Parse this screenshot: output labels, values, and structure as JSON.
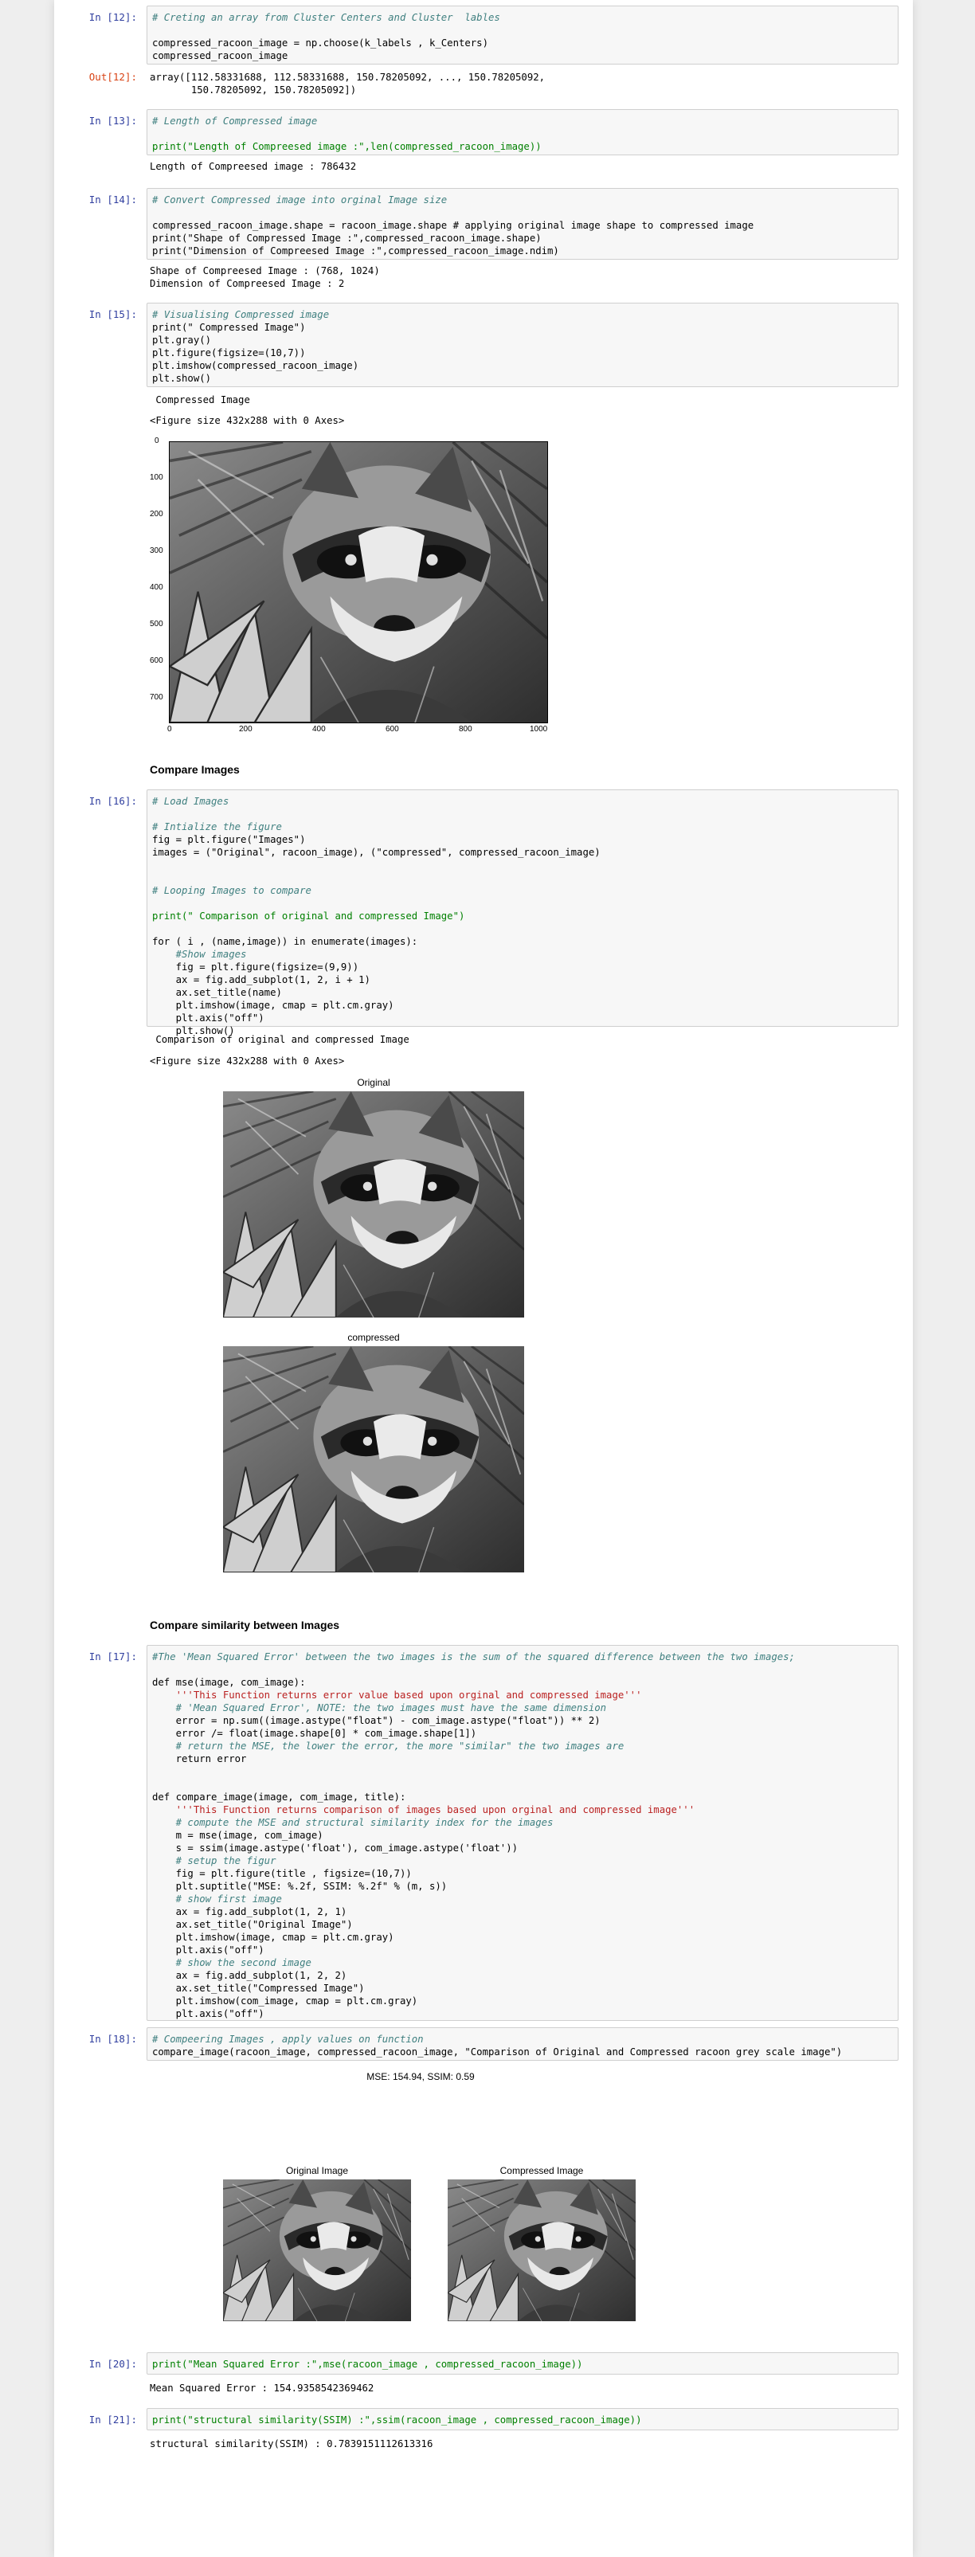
{
  "cells": {
    "c12": {
      "in_prompt": "In [12]:",
      "out_prompt": "Out[12]:",
      "code": [
        "# Creting an array from Cluster Centers and Cluster  lables",
        "",
        "compressed_racoon_image = np.choose(k_labels , k_Centers)",
        "compressed_racoon_image"
      ],
      "output": [
        "array([112.58331688, 112.58331688, 150.78205092, ..., 150.78205092,",
        "       150.78205092, 150.78205092])"
      ]
    },
    "c13": {
      "in_prompt": "In [13]:",
      "code": [
        "# Length of Compressed image",
        "",
        "print(\"Length of Compreesed image :\",len(compressed_racoon_image))"
      ],
      "output": "Length of Compreesed image : 786432"
    },
    "c14": {
      "in_prompt": "In [14]:",
      "code": [
        "# Convert Compressed image into orginal Image size",
        "",
        "compressed_racoon_image.shape = racoon_image.shape # applying original image shape to compressed image",
        "print(\"Shape of Compressed Image :\",compressed_racoon_image.shape)",
        "print(\"Dimension of Compreesed Image :\",compressed_racoon_image.ndim)"
      ],
      "output": [
        "Shape of Compreesed Image : (768, 1024)",
        "Dimension of Compreesed Image : 2"
      ]
    },
    "c15": {
      "in_prompt": "In [15]:",
      "code": [
        "# Visualising Compressed image",
        "print(\" Compressed Image\")",
        "plt.gray()",
        "plt.figure(figsize=(10,7))",
        "plt.imshow(compressed_racoon_image)",
        "plt.show()"
      ],
      "output_1": " Compressed Image",
      "output_2": "<Figure size 432x288 with 0 Axes>",
      "y_ticks": [
        "0",
        "100",
        "200",
        "300",
        "400",
        "500",
        "600",
        "700"
      ],
      "x_ticks": [
        "0",
        "200",
        "400",
        "600",
        "800",
        "1000"
      ]
    },
    "md_compare": "Compare Images",
    "c16": {
      "in_prompt": "In [16]:",
      "code": [
        "# Load Images",
        "",
        "# Intialize the figure",
        "fig = plt.figure(\"Images\")",
        "images = (\"Original\", racoon_image), (\"compressed\", compressed_racoon_image)",
        "",
        "",
        "# Looping Images to compare",
        "",
        "print(\" Comparison of original and compressed Image\")",
        "",
        "for ( i , (name,image)) in enumerate(images):",
        "    #Show images",
        "    fig = plt.figure(figsize=(9,9))",
        "    ax = fig.add_subplot(1, 2, i + 1)",
        "    ax.set_title(name)",
        "    plt.imshow(image, cmap = plt.cm.gray)",
        "    plt.axis(\"off\")",
        "    plt.show()"
      ],
      "output_1": " Comparison of original and compressed Image",
      "output_2": "<Figure size 432x288 with 0 Axes>",
      "title_original": "Original",
      "title_compressed": "compressed"
    },
    "md_similarity": "Compare similarity between Images",
    "c17": {
      "in_prompt": "In [17]:",
      "code": [
        "#The 'Mean Squared Error' between the two images is the sum of the squared difference between the two images;",
        "",
        "def mse(image, com_image):",
        "    '''This Function returns error value based upon orginal and compressed image'''",
        "    # 'Mean Squared Error', NOTE: the two images must have the same dimension",
        "    error = np.sum((image.astype(\"float\") - com_image.astype(\"float\")) ** 2)",
        "    error /= float(image.shape[0] * com_image.shape[1])",
        "    # return the MSE, the lower the error, the more \"similar\" the two images are",
        "    return error",
        "",
        "",
        "def compare_image(image, com_image, title):",
        "    '''This Function returns comparison of images based upon orginal and compressed image'''",
        "    # compute the MSE and structural similarity index for the images",
        "    m = mse(image, com_image)",
        "    s = ssim(image.astype('float'), com_image.astype('float'))",
        "    # setup the figur",
        "    fig = plt.figure(title , figsize=(10,7))",
        "    plt.suptitle(\"MSE: %.2f, SSIM: %.2f\" % (m, s))",
        "    # show first image",
        "    ax = fig.add_subplot(1, 2, 1)",
        "    ax.set_title(\"Original Image\")",
        "    plt.imshow(image, cmap = plt.cm.gray)",
        "    plt.axis(\"off\")",
        "    # show the second image",
        "    ax = fig.add_subplot(1, 2, 2)",
        "    ax.set_title(\"Compressed Image\")",
        "    plt.imshow(com_image, cmap = plt.cm.gray)",
        "    plt.axis(\"off\")"
      ]
    },
    "c18": {
      "in_prompt": "In [18]:",
      "code": [
        "# Compeering Images , apply values on function",
        "compare_image(racoon_image, compressed_racoon_image, \"Comparison of Original and Compressed racoon grey scale image\")"
      ],
      "suptitle": "MSE: 154.94, SSIM: 0.59",
      "title_left": "Original Image",
      "title_right": "Compressed Image"
    },
    "c20": {
      "in_prompt": "In [20]:",
      "code": [
        "print(\"Mean Squared Error :\",mse(racoon_image , compressed_racoon_image))"
      ],
      "output": "Mean Squared Error : 154.9358542369462"
    },
    "c21": {
      "in_prompt": "In [21]:",
      "code": [
        "print(\"structural similarity(SSIM) :\",ssim(racoon_image , compressed_racoon_image))"
      ],
      "output": "structural similarity(SSIM) : 0.7839151112613316"
    }
  },
  "colors": {
    "in_prompt": "#303f9f",
    "out_prompt": "#d84315",
    "comment": "#408080",
    "string": "#ba2121",
    "keyword": "#008000"
  }
}
